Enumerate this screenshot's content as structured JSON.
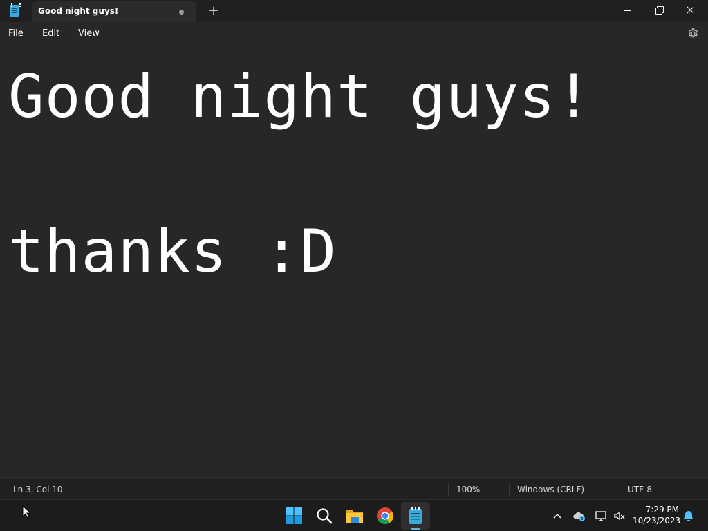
{
  "window": {
    "tab_title": "Good night guys!",
    "new_tab_glyph": "+",
    "app_icon": "notepad-icon"
  },
  "menu": {
    "file": "File",
    "edit": "Edit",
    "view": "View",
    "settings_icon": "gear-icon"
  },
  "editor": {
    "lines": [
      "Good night guys!",
      "",
      "thanks :D"
    ]
  },
  "statusbar": {
    "position": "Ln 3, Col 10",
    "zoom": "100%",
    "line_ending": "Windows (CRLF)",
    "encoding": "UTF-8"
  },
  "taskbar": {
    "apps": [
      "start-icon",
      "search-icon",
      "file-explorer-icon",
      "chrome-icon",
      "notepad-icon"
    ],
    "active_app": "notepad-icon",
    "tray": [
      "chevron-up-icon",
      "onedrive-icon",
      "network-icon",
      "volume-muted-icon",
      "notification-bell-icon"
    ],
    "time": "7:29 PM",
    "date": "10/23/2023"
  },
  "colors": {
    "background": "#272727",
    "titlebar": "#202020",
    "accent": "#5ab5e8",
    "text": "#ffffff"
  }
}
